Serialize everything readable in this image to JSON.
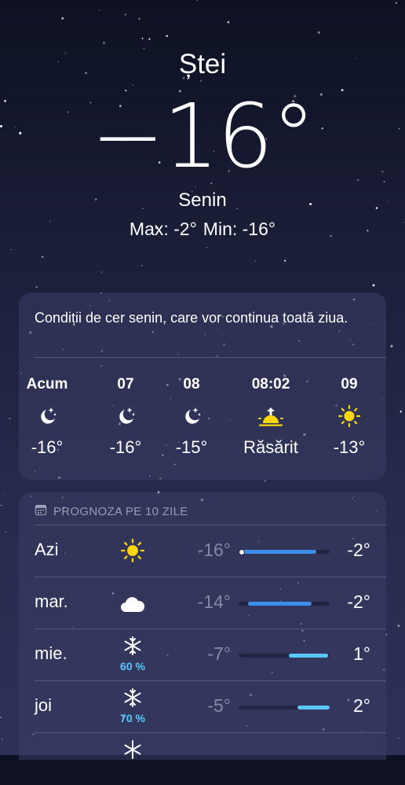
{
  "location": {
    "city": "Ștei"
  },
  "current": {
    "temperature": "−16°",
    "condition": "Senin",
    "max_label": "Max: -2°",
    "min_label": "Min: -16°"
  },
  "summary": {
    "text": "Condiții de cer senin, care vor continua toată ziua.",
    "hours": [
      {
        "label": "Acum",
        "icon": "moon-stars-icon",
        "temp": "-16°"
      },
      {
        "label": "07",
        "icon": "moon-stars-icon",
        "temp": "-16°"
      },
      {
        "label": "08",
        "icon": "moon-stars-icon",
        "temp": "-15°"
      },
      {
        "label": "08:02",
        "icon": "sunrise-icon",
        "temp": "Răsărit"
      },
      {
        "label": "09",
        "icon": "sun-icon",
        "temp": "-13°"
      }
    ]
  },
  "forecast": {
    "header": "PROGNOZA PE 10 ZILE",
    "days": [
      {
        "day": "Azi",
        "icon": "sun-icon",
        "pop": "",
        "low": "-16°",
        "high": "-2°",
        "range_start": 0.05,
        "range_end": 0.85,
        "current_marker": 0.05,
        "color": "#3b8fe8"
      },
      {
        "day": "mar.",
        "icon": "cloud-icon",
        "pop": "",
        "low": "-14°",
        "high": "-2°",
        "range_start": 0.1,
        "range_end": 0.8,
        "color": "#3b8fe8"
      },
      {
        "day": "mie.",
        "icon": "snowflake-icon",
        "pop": "60 %",
        "low": "-7°",
        "high": "1°",
        "range_start": 0.55,
        "range_end": 0.98,
        "color": "#5ac8fa"
      },
      {
        "day": "joi",
        "icon": "snowflake-icon",
        "pop": "70 %",
        "low": "-5°",
        "high": "2°",
        "range_start": 0.65,
        "range_end": 1.0,
        "color": "#5ac8fa"
      }
    ]
  },
  "colors": {
    "accent_blue": "#3b8fe8",
    "accent_light_blue": "#5ac8fa",
    "sun_yellow": "#ffd60a"
  }
}
